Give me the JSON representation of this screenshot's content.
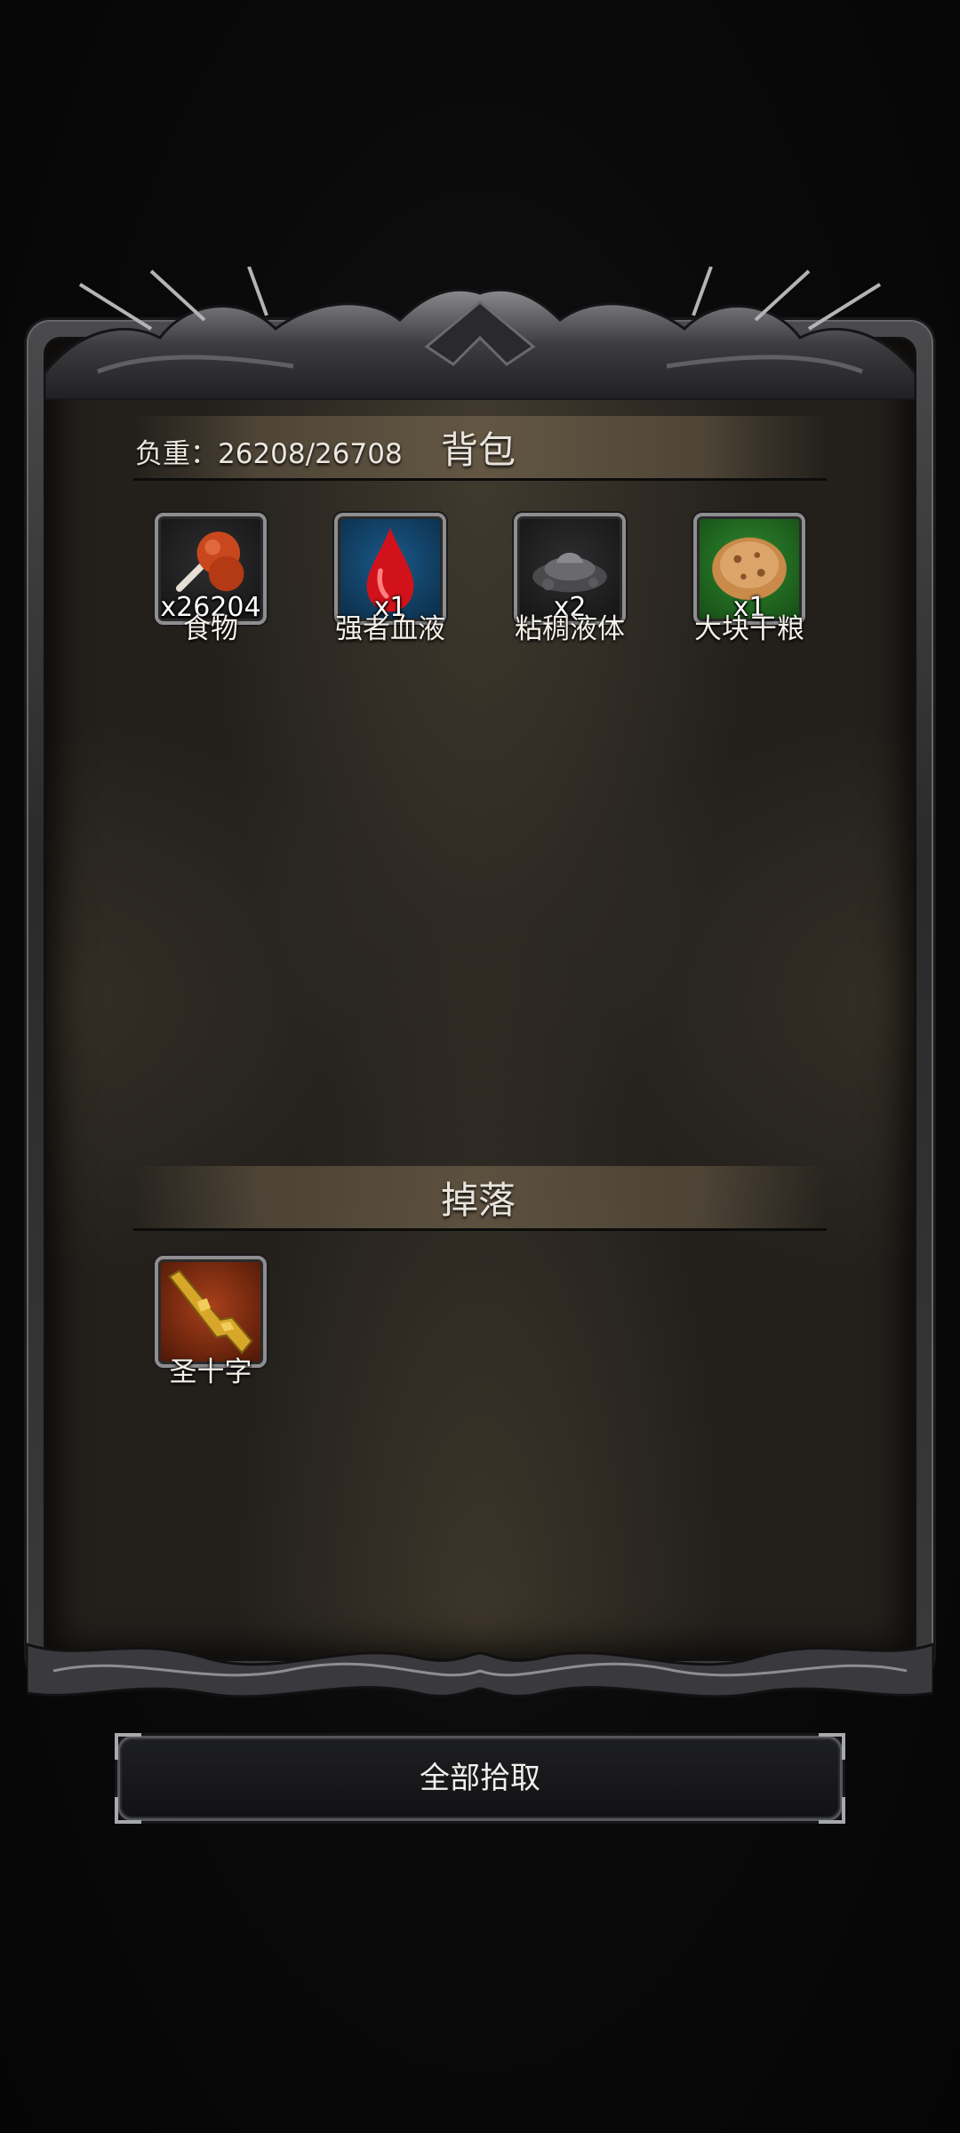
{
  "inventory": {
    "weight_label": "负重：26208/26708",
    "title": "背包",
    "items": [
      {
        "name": "食物",
        "qty": "x26204",
        "icon": "roasted-meat-icon",
        "rarity": "gray"
      },
      {
        "name": "强者血液",
        "qty": "x1",
        "icon": "blood-drop-icon",
        "rarity": "blue"
      },
      {
        "name": "粘稠液体",
        "qty": "x2",
        "icon": "sticky-liquid-icon",
        "rarity": "gray"
      },
      {
        "name": "大块干粮",
        "qty": "x1",
        "icon": "biscuit-icon",
        "rarity": "green"
      }
    ]
  },
  "drops": {
    "title": "掉落",
    "items": [
      {
        "name": "圣十字",
        "qty": "",
        "icon": "golden-rifle-icon",
        "rarity": "orange"
      }
    ]
  },
  "actions": {
    "pickup_all_label": "全部拾取"
  },
  "colors": {
    "rarity_gray": "#1e1e20",
    "rarity_blue": "#0f3d63",
    "rarity_green": "#1f6e1f",
    "rarity_orange": "#7a2c0c",
    "text": "#f4f0e8"
  }
}
